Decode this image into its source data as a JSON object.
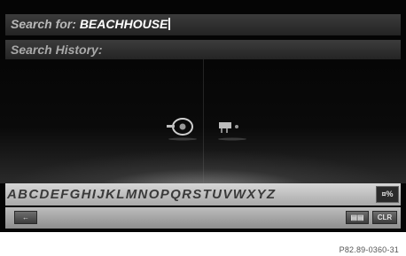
{
  "search": {
    "label": "Search for:",
    "query": "BEACHHOUSE"
  },
  "history": {
    "label": "Search History:"
  },
  "scene_icons": [
    "steering-wheel-icon",
    "bed-icon"
  ],
  "keyboard": {
    "letters": "ABCDEFGHIJKLMNOPQRSTUVWXYZ",
    "mode_label": "¤%"
  },
  "controls": {
    "back_label": "←",
    "lang_label": "▤▤",
    "clear_label": "CLR"
  },
  "caption": "P82.89-0360-31"
}
